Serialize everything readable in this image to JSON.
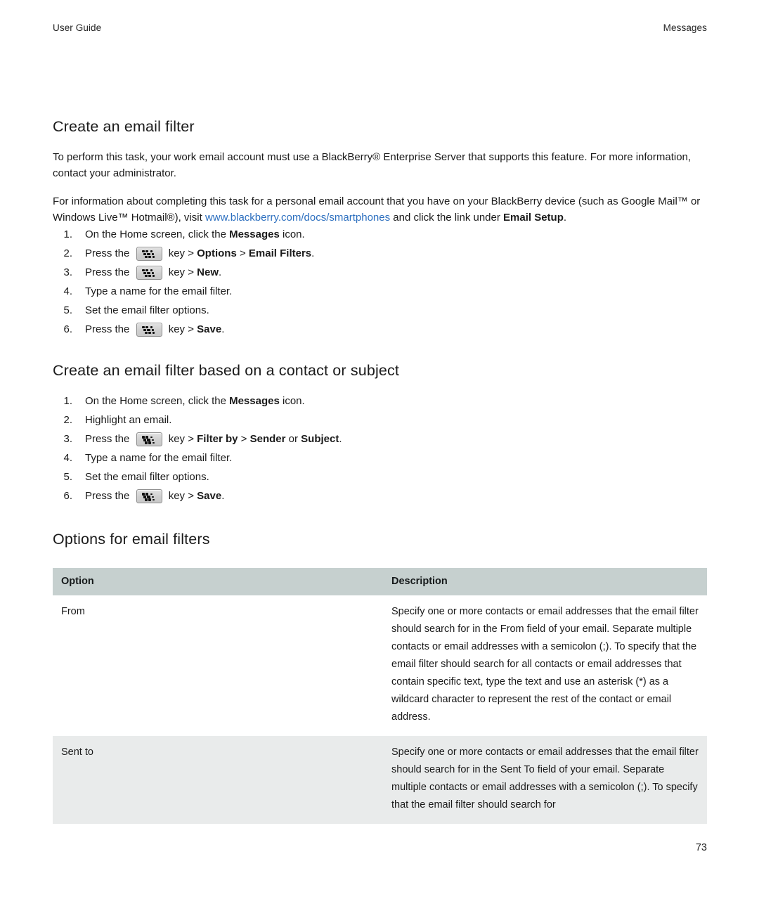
{
  "header": {
    "left": "User Guide",
    "right": "Messages"
  },
  "sections": [
    {
      "title": "Create an email filter",
      "paragraphs": [
        {
          "parts": [
            {
              "text": "To perform this task, your work email account must use a BlackBerry® Enterprise Server that supports this feature. For more information, contact your administrator.",
              "style": "normal"
            }
          ]
        },
        {
          "parts": [
            {
              "text": "For information about completing this task for a personal email account that you have on your BlackBerry device (such as Google Mail™ or Windows Live™ Hotmail®), visit ",
              "style": "normal"
            },
            {
              "text": "www.blackberry.com/docs/smartphones",
              "style": "link"
            },
            {
              "text": " and click the link under ",
              "style": "normal"
            },
            {
              "text": "Email Setup",
              "style": "bold"
            },
            {
              "text": ".",
              "style": "normal"
            }
          ]
        }
      ],
      "steps": [
        {
          "number": "1.",
          "parts": [
            {
              "text": "On the Home screen, click the ",
              "style": "normal"
            },
            {
              "text": "Messages",
              "style": "bold"
            },
            {
              "text": " icon.",
              "style": "normal"
            }
          ]
        },
        {
          "number": "2.",
          "parts": [
            {
              "text": "Press the ",
              "style": "normal"
            },
            {
              "text": "menu-key-icon",
              "style": "icon"
            },
            {
              "text": " key > ",
              "style": "normal"
            },
            {
              "text": "Options",
              "style": "bold"
            },
            {
              "text": " > ",
              "style": "normal"
            },
            {
              "text": "Email Filters",
              "style": "bold"
            },
            {
              "text": ".",
              "style": "normal"
            }
          ]
        },
        {
          "number": "3.",
          "parts": [
            {
              "text": "Press the ",
              "style": "normal"
            },
            {
              "text": "menu-key-icon",
              "style": "icon"
            },
            {
              "text": " key > ",
              "style": "normal"
            },
            {
              "text": "New",
              "style": "bold"
            },
            {
              "text": ".",
              "style": "normal"
            }
          ]
        },
        {
          "number": "4.",
          "parts": [
            {
              "text": "Type a name for the email filter.",
              "style": "normal"
            }
          ]
        },
        {
          "number": "5.",
          "parts": [
            {
              "text": "Set the email filter options.",
              "style": "normal"
            }
          ]
        },
        {
          "number": "6.",
          "parts": [
            {
              "text": "Press the ",
              "style": "normal"
            },
            {
              "text": "menu-key-icon",
              "style": "icon"
            },
            {
              "text": " key > ",
              "style": "normal"
            },
            {
              "text": "Save",
              "style": "bold"
            },
            {
              "text": ".",
              "style": "normal"
            }
          ]
        }
      ]
    },
    {
      "title": "Create an email filter based on a contact or subject",
      "paragraphs": [],
      "steps": [
        {
          "number": "1.",
          "parts": [
            {
              "text": "On the Home screen, click the ",
              "style": "normal"
            },
            {
              "text": "Messages",
              "style": "bold"
            },
            {
              "text": " icon.",
              "style": "normal"
            }
          ]
        },
        {
          "number": "2.",
          "parts": [
            {
              "text": "Highlight an email.",
              "style": "normal"
            }
          ]
        },
        {
          "number": "3.",
          "parts": [
            {
              "text": "Press the ",
              "style": "normal"
            },
            {
              "text": "menu-key-icon",
              "style": "icon"
            },
            {
              "text": " key > ",
              "style": "normal"
            },
            {
              "text": "Filter by",
              "style": "bold"
            },
            {
              "text": " > ",
              "style": "normal"
            },
            {
              "text": "Sender",
              "style": "bold"
            },
            {
              "text": " or ",
              "style": "normal"
            },
            {
              "text": "Subject",
              "style": "bold"
            },
            {
              "text": ".",
              "style": "normal"
            }
          ]
        },
        {
          "number": "4.",
          "parts": [
            {
              "text": "Type a name for the email filter.",
              "style": "normal"
            }
          ]
        },
        {
          "number": "5.",
          "parts": [
            {
              "text": "Set the email filter options.",
              "style": "normal"
            }
          ]
        },
        {
          "number": "6.",
          "parts": [
            {
              "text": "Press the ",
              "style": "normal"
            },
            {
              "text": "menu-key-icon",
              "style": "icon"
            },
            {
              "text": " key > ",
              "style": "normal"
            },
            {
              "text": "Save",
              "style": "bold"
            },
            {
              "text": ".",
              "style": "normal"
            }
          ]
        }
      ]
    },
    {
      "title": "Options for email filters",
      "paragraphs": [],
      "steps": []
    }
  ],
  "table": {
    "columns": [
      "Option",
      "Description"
    ],
    "rows": [
      {
        "option": "From",
        "description": "Specify one or more contacts or email addresses that the email filter should search for in the From field of your email. Separate multiple contacts or email addresses with a semicolon (;). To specify that the email filter should search for all contacts or email addresses that contain specific text, type the text and use an asterisk (*) as a wildcard character to represent the rest of the contact or email address."
      },
      {
        "option": "Sent to",
        "description": "Specify one or more contacts or email addresses that the email filter should search for in the Sent To field of your email. Separate multiple contacts or email addresses with a semicolon (;). To specify that the email filter should search for"
      }
    ]
  },
  "footer": {
    "page_number": "73"
  },
  "colors": {
    "link": "#2c6fbf",
    "table_header_bg": "#c6d0cf",
    "table_alt_row_bg": "#e9ebeb",
    "text": "#1a1a1a"
  }
}
